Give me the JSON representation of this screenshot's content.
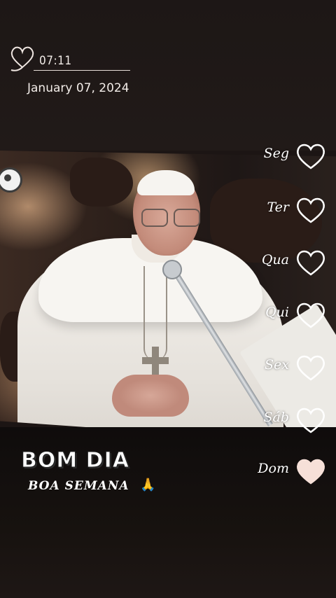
{
  "header": {
    "time": "07:11",
    "date": "January 07, 2024"
  },
  "days": [
    {
      "label": "Seg",
      "state": "outline"
    },
    {
      "label": "Ter",
      "state": "outline"
    },
    {
      "label": "Qua",
      "state": "outline"
    },
    {
      "label": "Qui",
      "state": "outline"
    },
    {
      "label": "Sex",
      "state": "outline"
    },
    {
      "label": "Sáb",
      "state": "outline"
    },
    {
      "label": "Dom",
      "state": "filled"
    }
  ],
  "greeting": {
    "title": "BOM DIA",
    "subtitle": "BOA SEMANA"
  },
  "colors": {
    "heart_filled": "#f6e0d8",
    "heart_outline": "#ffffff",
    "text": "#ffffff"
  }
}
